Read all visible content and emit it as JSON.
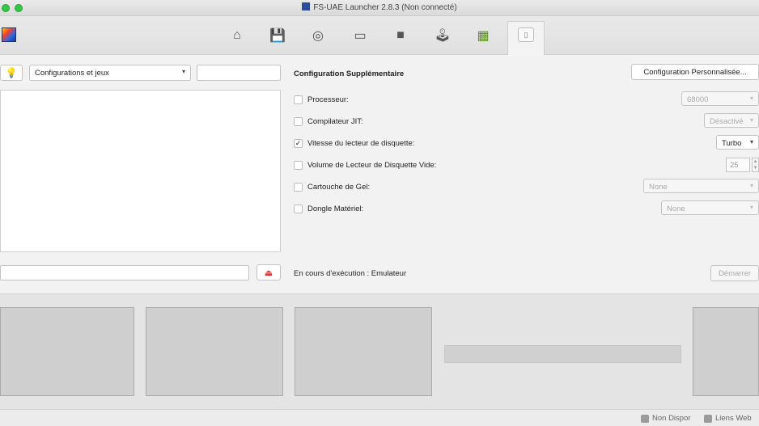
{
  "window": {
    "title": "FS-UAE Launcher 2.8.3 (Non connecté)"
  },
  "toolbar": {
    "tabs": [
      {
        "icon": "home-icon",
        "glyph": "⌂"
      },
      {
        "icon": "floppy-disk-icon",
        "glyph": "💾"
      },
      {
        "icon": "cdrom-icon",
        "glyph": "◎"
      },
      {
        "icon": "hard-drive-icon",
        "glyph": "▭"
      },
      {
        "icon": "input-device-icon",
        "glyph": "■"
      },
      {
        "icon": "joystick-icon",
        "glyph": "🕹"
      },
      {
        "icon": "expansion-card-icon",
        "glyph": "▦"
      },
      {
        "icon": "usb-additional-icon",
        "glyph": "▯",
        "selected": true
      }
    ]
  },
  "left_panel": {
    "config_filter": "Configurations et jeux",
    "search_value": "",
    "path_value": ""
  },
  "config": {
    "title": "Configuration Supplémentaire",
    "custom_button": "Configuration Personnalisée...",
    "options": [
      {
        "label": "Processeur:",
        "checked": false,
        "value": "68000",
        "enabled": false
      },
      {
        "label": "Compilateur JIT:",
        "checked": false,
        "value": "Désactivé",
        "enabled": false
      },
      {
        "label": "Vitesse du lecteur de disquette:",
        "checked": true,
        "value": "Turbo",
        "enabled": true
      },
      {
        "label": "Volume de Lecteur de Disquette Vide:",
        "checked": false,
        "value": "25",
        "enabled": false
      },
      {
        "label": "Cartouche de Gel:",
        "checked": false,
        "value": "None",
        "enabled": false
      },
      {
        "label": "Dongle Matériel:",
        "checked": false,
        "value": "None",
        "enabled": false
      }
    ],
    "checkmark": "✓"
  },
  "run": {
    "status": "En cours d'exécution : Emulateur",
    "start_button": "Démarrer"
  },
  "statusbar": {
    "not_available": "Non Dispor",
    "web_links": "Liens Web"
  }
}
